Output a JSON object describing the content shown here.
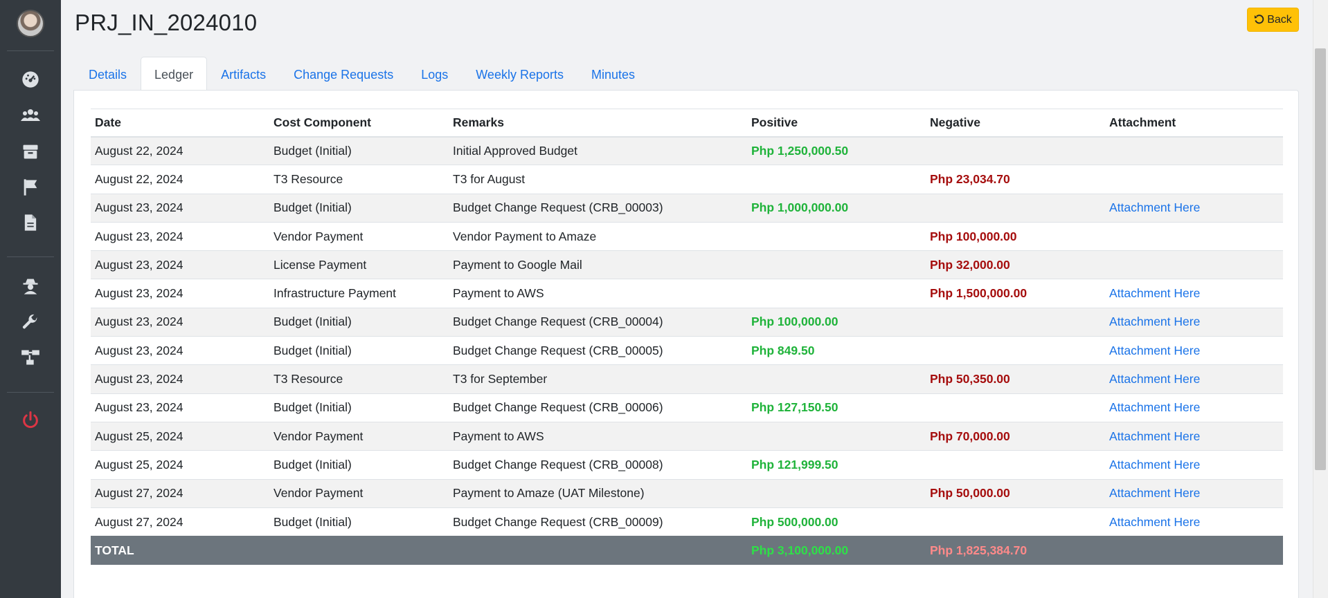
{
  "page": {
    "title": "PRJ_IN_2024010",
    "back_label": "Back"
  },
  "sidebar": {
    "icons": [
      "avatar",
      "dashboard-icon",
      "users-icon",
      "box-icon",
      "flag-icon",
      "file-icon",
      "user-secret-icon",
      "wrench-icon",
      "network-icon",
      "power-icon"
    ]
  },
  "tabs": [
    {
      "label": "Details"
    },
    {
      "label": "Ledger"
    },
    {
      "label": "Artifacts"
    },
    {
      "label": "Change Requests"
    },
    {
      "label": "Logs"
    },
    {
      "label": "Weekly Reports"
    },
    {
      "label": "Minutes"
    }
  ],
  "table": {
    "headers": [
      "Date",
      "Cost Component",
      "Remarks",
      "Positive",
      "Negative",
      "Attachment"
    ],
    "rows": [
      {
        "date": "August 22, 2024",
        "cost": "Budget (Initial)",
        "remarks": "Initial Approved Budget",
        "positive": "Php 1,250,000.50",
        "negative": "",
        "attachment": ""
      },
      {
        "date": "August 22, 2024",
        "cost": "T3 Resource",
        "remarks": "T3 for August",
        "positive": "",
        "negative": "Php 23,034.70",
        "attachment": ""
      },
      {
        "date": "August 23, 2024",
        "cost": "Budget (Initial)",
        "remarks": "Budget Change Request (CRB_00003)",
        "positive": "Php 1,000,000.00",
        "negative": "",
        "attachment": "Attachment Here"
      },
      {
        "date": "August 23, 2024",
        "cost": "Vendor Payment",
        "remarks": "Vendor Payment to Amaze",
        "positive": "",
        "negative": "Php 100,000.00",
        "attachment": ""
      },
      {
        "date": "August 23, 2024",
        "cost": "License Payment",
        "remarks": "Payment to Google Mail",
        "positive": "",
        "negative": "Php 32,000.00",
        "attachment": ""
      },
      {
        "date": "August 23, 2024",
        "cost": "Infrastructure Payment",
        "remarks": "Payment to AWS",
        "positive": "",
        "negative": "Php 1,500,000.00",
        "attachment": "Attachment Here"
      },
      {
        "date": "August 23, 2024",
        "cost": "Budget (Initial)",
        "remarks": "Budget Change Request (CRB_00004)",
        "positive": "Php 100,000.00",
        "negative": "",
        "attachment": "Attachment Here"
      },
      {
        "date": "August 23, 2024",
        "cost": "Budget (Initial)",
        "remarks": "Budget Change Request (CRB_00005)",
        "positive": "Php 849.50",
        "negative": "",
        "attachment": "Attachment Here"
      },
      {
        "date": "August 23, 2024",
        "cost": "T3 Resource",
        "remarks": "T3 for September",
        "positive": "",
        "negative": "Php 50,350.00",
        "attachment": "Attachment Here"
      },
      {
        "date": "August 23, 2024",
        "cost": "Budget (Initial)",
        "remarks": "Budget Change Request (CRB_00006)",
        "positive": "Php 127,150.50",
        "negative": "",
        "attachment": "Attachment Here"
      },
      {
        "date": "August 25, 2024",
        "cost": "Vendor Payment",
        "remarks": "Payment to AWS",
        "positive": "",
        "negative": "Php 70,000.00",
        "attachment": "Attachment Here"
      },
      {
        "date": "August 25, 2024",
        "cost": "Budget (Initial)",
        "remarks": "Budget Change Request (CRB_00008)",
        "positive": "Php 121,999.50",
        "negative": "",
        "attachment": "Attachment Here"
      },
      {
        "date": "August 27, 2024",
        "cost": "Vendor Payment",
        "remarks": "Payment to Amaze (UAT Milestone)",
        "positive": "",
        "negative": "Php 50,000.00",
        "attachment": "Attachment Here"
      },
      {
        "date": "August 27, 2024",
        "cost": "Budget (Initial)",
        "remarks": "Budget Change Request (CRB_00009)",
        "positive": "Php 500,000.00",
        "negative": "",
        "attachment": "Attachment Here"
      }
    ],
    "total": {
      "label": "TOTAL",
      "positive": "Php 3,100,000.00",
      "negative": "Php 1,825,384.70"
    }
  },
  "colors": {
    "positive": "#1fb33a",
    "negative": "#a50d0d",
    "link": "#1a73e8",
    "back_button": "#ffc107",
    "sidebar": "#343a40",
    "power": "#dc3545"
  }
}
